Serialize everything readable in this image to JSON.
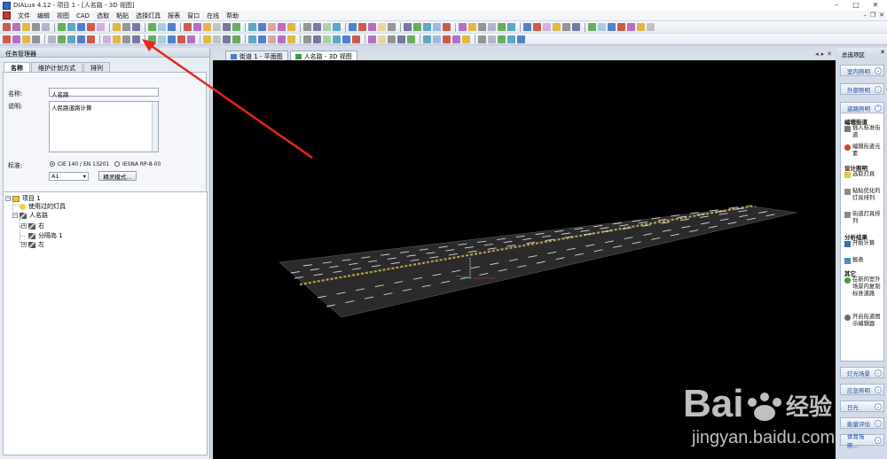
{
  "window": {
    "title": "DIALux 4.12 - 项目 1 - [人名路 - 3D 视图]"
  },
  "menu": {
    "items": [
      "文件",
      "编辑",
      "视图",
      "CAD",
      "选取",
      "粘贴",
      "选择灯具",
      "报表",
      "窗口",
      "在线",
      "帮助"
    ]
  },
  "left_panel": {
    "title": "任务管理器",
    "tabs": [
      "名称",
      "维护计划方式",
      "排列"
    ],
    "form": {
      "name_label": "名称:",
      "name_value": "人名路",
      "desc_label": "说明:",
      "desc_value": "人民路道路计算",
      "standard_label": "标准:",
      "standard_opt1": "CIE 140 / EN 13201",
      "standard_opt2": "IESNA RP-8-00",
      "class_value": "A1",
      "expert_button": "精灵模式..."
    },
    "tree": {
      "project": "项目 1",
      "used_luminaires": "使用过的灯具",
      "road": "人名路",
      "right": "右",
      "median": "分隔岛 1",
      "left": "左"
    }
  },
  "doc_tabs": [
    {
      "label": "街道 1 - 平面图",
      "active": false
    },
    {
      "label": "人名路 - 3D 视图",
      "active": true
    }
  ],
  "right_panel": {
    "title": "总选项区",
    "sections_top": [
      "室内照明",
      "外部照明",
      "道路照明"
    ],
    "groups": {
      "edit_road": "编辑街道",
      "design_lighting": "设计照明",
      "analysis": "分析结果",
      "other": "其它"
    },
    "items": {
      "insert_std_road": "插入标准街道",
      "edit_road_element": "编辑街道元素",
      "pick_luminaire": "选取灯具",
      "optimized_arrangement": "粘贴优化的灯具排列",
      "road_luminaire_arrangement": "街道灯具排列",
      "start_calc": "开始计算",
      "report": "报表",
      "new_indoor": "在新的室外场景内复制标准道路",
      "open_road_editor": "开启街道图示编辑器"
    },
    "sections_bottom": [
      "灯光场景",
      "应急照明",
      "日光",
      "能量评估",
      "体育场照..."
    ]
  },
  "watermark": {
    "brand": "Bai",
    "brand2": "经验",
    "url": "jingyan.baidu.com"
  },
  "colors": {
    "accent": "#1a4fa0",
    "viewport_bg": "#000000",
    "road": "#2b2b2b",
    "center_line": "#b8a14a",
    "annotation_arrow": "#e8261a"
  }
}
